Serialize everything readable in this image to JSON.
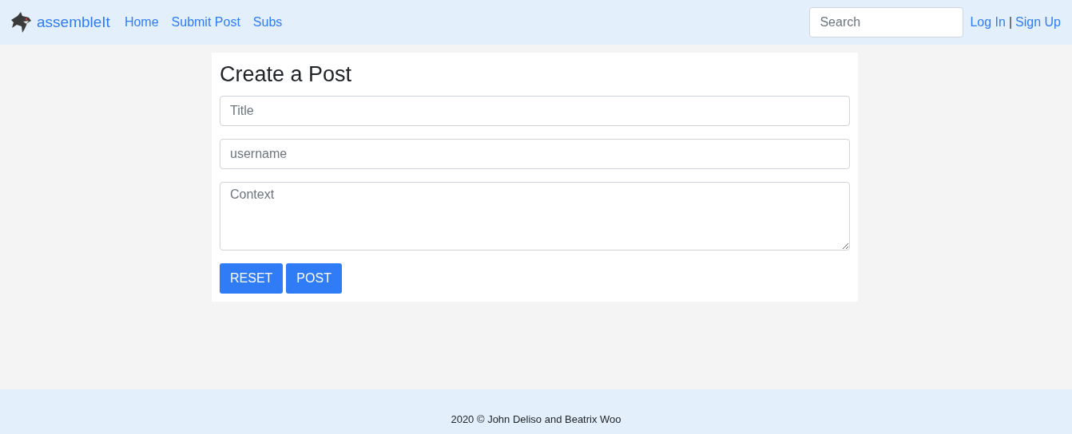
{
  "navbar": {
    "brand": "assembleIt",
    "links": [
      "Home",
      "Submit Post",
      "Subs"
    ],
    "search": {
      "placeholder": "Search"
    },
    "auth": {
      "login": "Log In",
      "separator": "|",
      "signup": "Sign Up"
    }
  },
  "form": {
    "title": "Create a Post",
    "fields": [
      {
        "kind": "input",
        "placeholder": "Title"
      },
      {
        "kind": "input",
        "placeholder": "username"
      },
      {
        "kind": "textarea",
        "placeholder": "Context"
      }
    ],
    "buttons": [
      "RESET",
      "POST"
    ]
  },
  "footer": {
    "text": "2020 © John Deliso and Beatrix Woo"
  }
}
